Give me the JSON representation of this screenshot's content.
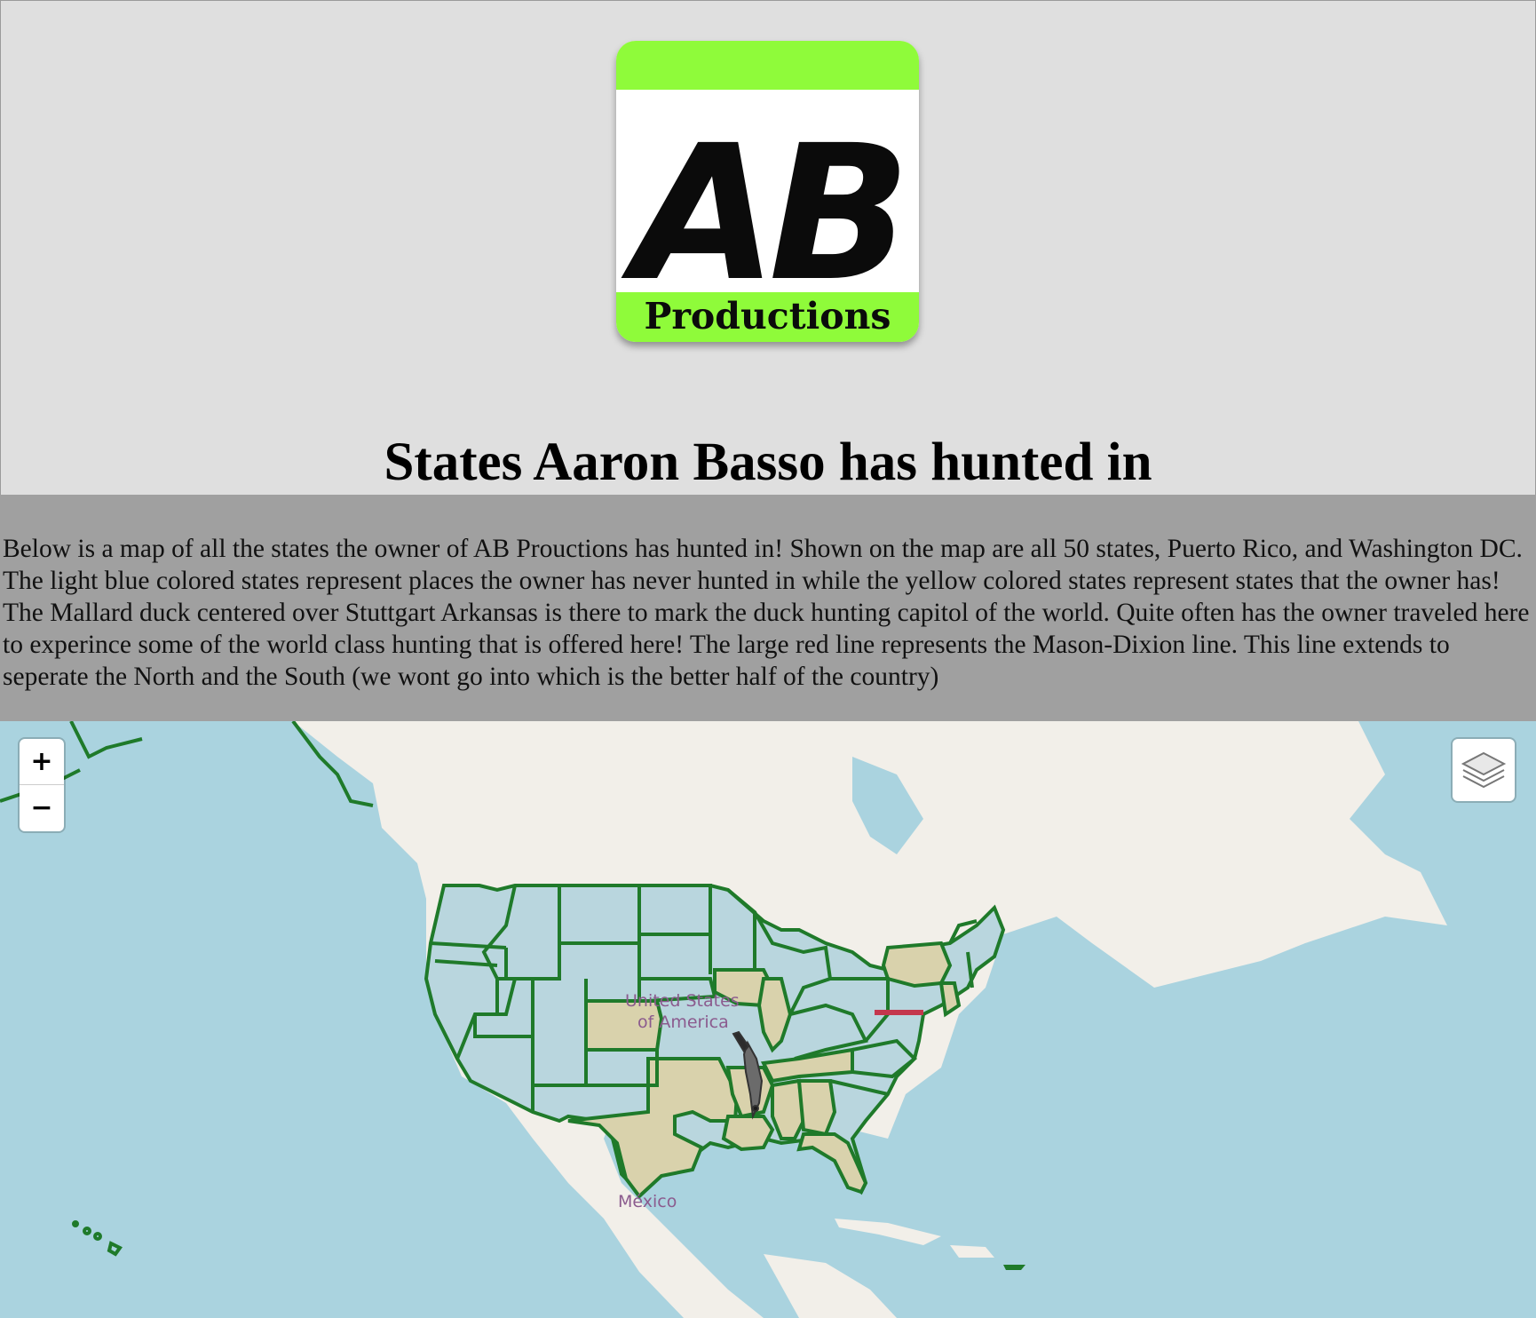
{
  "logo": {
    "letters": "AB",
    "word": "Productions",
    "accent_color": "#8ffb3a"
  },
  "page": {
    "title": "States Aaron Basso has hunted in",
    "description": "Below is a map of all the states the owner of AB Prouctions has hunted in! Shown on the map are all 50 states, Puerto Rico, and Washington DC. The light blue colored states represent places the owner has never hunted in while the yellow colored states represent states that the owner has! The Mallard duck centered over Stuttgart Arkansas is there to mark the duck hunting capitol of the world. Quite often has the owner traveled here to experince some of the world class hunting that is offered here! The large red line represents the Mason-Dixion line. This line extends to seperate the North and the South (we wont go into which is the better half of the country)"
  },
  "map": {
    "zoom_in_label": "+",
    "zoom_out_label": "−",
    "layers_icon": "layers-icon",
    "base_labels": {
      "country_us_line1": "United States",
      "country_us_line2": "of America",
      "country_mx": "México"
    },
    "colors": {
      "water": "#aad3df",
      "land": "#f2efe9",
      "never_hunted_fill": "#b9d6de",
      "hunted_fill": "#d9d2ac",
      "state_border": "#1f7a2a",
      "mason_dixon_line": "#c4374d"
    },
    "marker": {
      "icon": "mallard-duck-icon",
      "location": "Stuttgart Arkansas"
    }
  }
}
